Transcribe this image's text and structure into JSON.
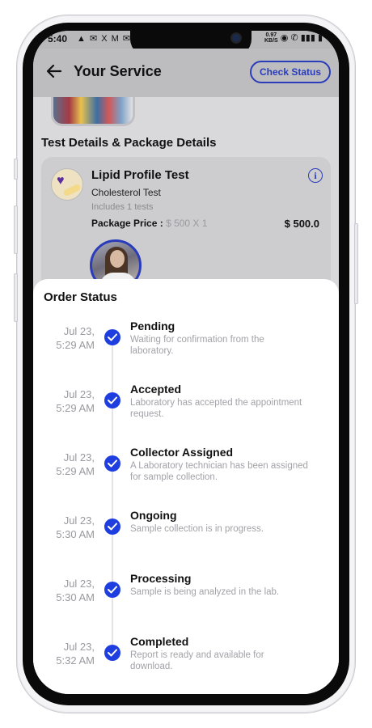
{
  "status_bar": {
    "time": "5:40",
    "left_icons": "▲ ✉ X M ✉",
    "speed_top": "0.97",
    "speed_bottom": "KB/S",
    "right_icons": "◉ ✆ ▮▮▮ ▮"
  },
  "header": {
    "title": "Your Service",
    "check_status_label": "Check Status"
  },
  "section_title": "Test Details & Package Details",
  "test": {
    "name": "Lipid Profile Test",
    "subtitle": "Cholesterol Test",
    "includes": "Includes 1 tests",
    "price_label": "Package Price : ",
    "price_multiplier": "$ 500 X 1",
    "price_total": "$ 500.0"
  },
  "order_status": {
    "title": "Order Status",
    "steps": [
      {
        "date": "Jul 23,",
        "time": "5:29 AM",
        "title": "Pending",
        "desc": "Waiting for confirmation from the laboratory."
      },
      {
        "date": "Jul 23,",
        "time": "5:29 AM",
        "title": "Accepted",
        "desc": "Laboratory has accepted the appointment request."
      },
      {
        "date": "Jul 23,",
        "time": "5:29 AM",
        "title": "Collector Assigned",
        "desc": "A Laboratory technician has been assigned for sample collection."
      },
      {
        "date": "Jul 23,",
        "time": "5:30 AM",
        "title": "Ongoing",
        "desc": "Sample collection is in progress."
      },
      {
        "date": "Jul 23,",
        "time": "5:30 AM",
        "title": "Processing",
        "desc": "Sample is being analyzed in the lab."
      },
      {
        "date": "Jul 23,",
        "time": "5:32 AM",
        "title": "Completed",
        "desc": "Report is ready and available for download."
      }
    ]
  },
  "colors": {
    "accent": "#1f3ee0",
    "accent_outline": "#2a3cba",
    "muted_text": "#a2a2a8"
  },
  "icons": {
    "back": "arrow-left-icon",
    "info": "info-icon",
    "check": "check-circle-icon"
  }
}
